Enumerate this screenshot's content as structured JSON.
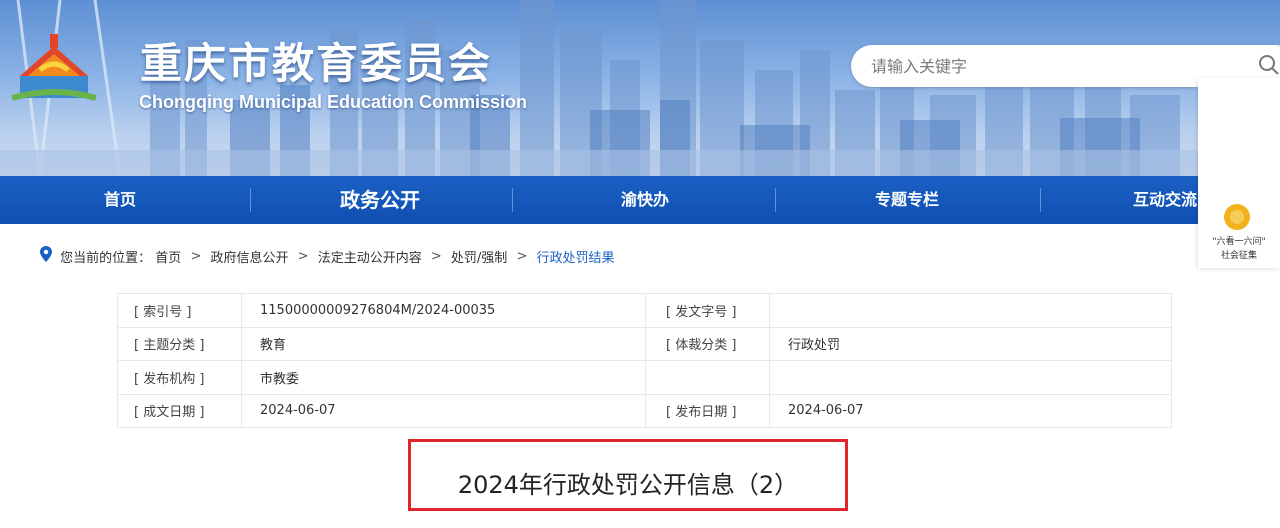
{
  "header": {
    "title": "重庆市教育委员会",
    "subtitle": "Chongqing Municipal Education Commission",
    "search_placeholder": "请输入关键字"
  },
  "nav": {
    "items": [
      {
        "label": "首页"
      },
      {
        "label": "政务公开",
        "active": true
      },
      {
        "label": "渝快办"
      },
      {
        "label": "专题专栏"
      },
      {
        "label": "互动交流"
      }
    ]
  },
  "side_widget": {
    "line1": "\"六看一六问\"",
    "line2": "社会征集"
  },
  "breadcrumb": {
    "prefix": "您当前的位置：",
    "items": [
      "首页",
      "政府信息公开",
      "法定主动公开内容",
      "处罚/强制",
      "行政处罚结果"
    ],
    "separator": ">"
  },
  "meta": {
    "rows": [
      {
        "label1": "[ 索引号 ]",
        "value1": "11500000009276804M/2024-00035",
        "label2": "[ 发文字号 ]",
        "value2": ""
      },
      {
        "label1": "[ 主题分类 ]",
        "value1": "教育",
        "label2": "[ 体裁分类 ]",
        "value2": "行政处罚"
      },
      {
        "label1": "[ 发布机构 ]",
        "value1": "市教委",
        "label2": "",
        "value2": ""
      },
      {
        "label1": "[ 成文日期 ]",
        "value1": "2024-06-07",
        "label2": "[ 发布日期 ]",
        "value2": "2024-06-07"
      }
    ]
  },
  "document": {
    "title": "2024年行政处罚公开信息（2）"
  },
  "colors": {
    "nav_blue": "#1b60c4",
    "highlight_red": "#e0262c",
    "banner_sky": "#8db4e6"
  }
}
